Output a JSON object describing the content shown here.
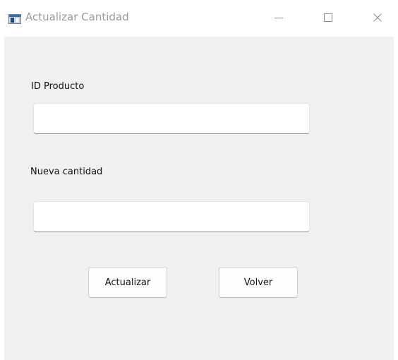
{
  "window": {
    "title": "Actualizar Cantidad",
    "icon": "app-window-icon",
    "controls": {
      "minimize_icon": "minimize-icon",
      "maximize_icon": "maximize-icon",
      "close_icon": "close-icon"
    }
  },
  "form": {
    "id_label": "ID Producto",
    "id_value": "",
    "quantity_label": "Nueva cantidad",
    "quantity_value": ""
  },
  "buttons": {
    "update_label": "Actualizar",
    "back_label": "Volver"
  },
  "colors": {
    "window_background": "#f0f0f0",
    "titlebar_background": "#ffffff",
    "title_text": "#9a9a9a",
    "input_underline": "#8a8a8a"
  }
}
